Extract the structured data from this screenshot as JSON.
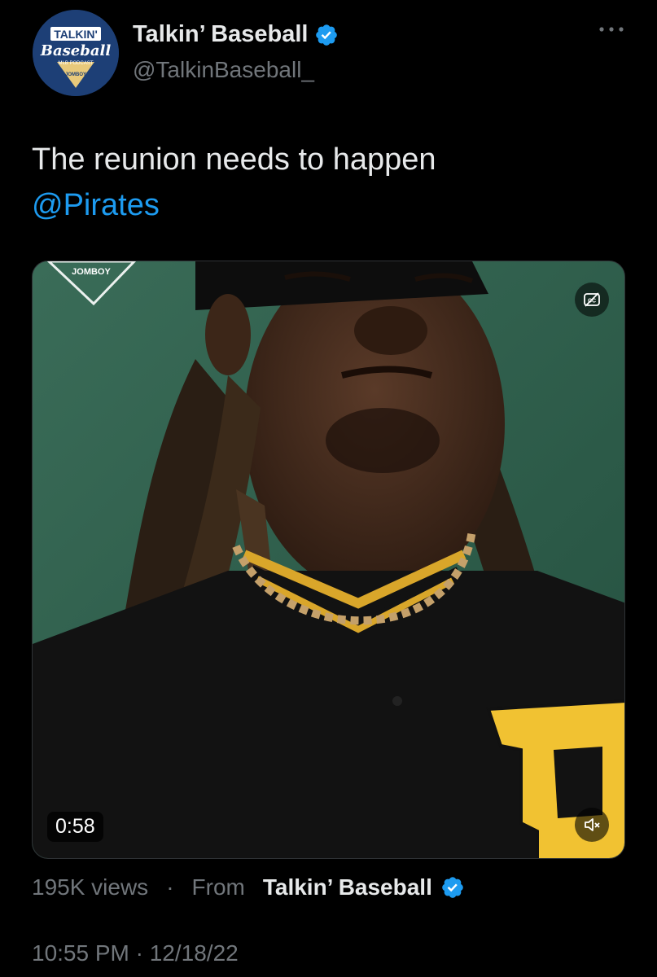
{
  "author": {
    "display_name": "Talkin’ Baseball",
    "handle": "@TalkinBaseball_",
    "avatar_logo_text": [
      "TALKIN'",
      "Baseball",
      "MLB PODCAST",
      "JOMBOY"
    ],
    "verified": true
  },
  "tweet": {
    "text_line1": "The reunion needs to happen",
    "mention": "@Pirates"
  },
  "media": {
    "duration": "0:58",
    "watermark_text": "JOMBOY",
    "jersey_letter": "P"
  },
  "stats": {
    "views": "195K views",
    "separator": "·",
    "from_label": "From",
    "source_name": "Talkin’ Baseball"
  },
  "timestamp": "10:55 PM · 12/18/22",
  "colors": {
    "background": "#000000",
    "primary_text": "#e7e9ea",
    "secondary_text": "#71767b",
    "link": "#1d9bf0",
    "verified": "#1d9bf0"
  }
}
